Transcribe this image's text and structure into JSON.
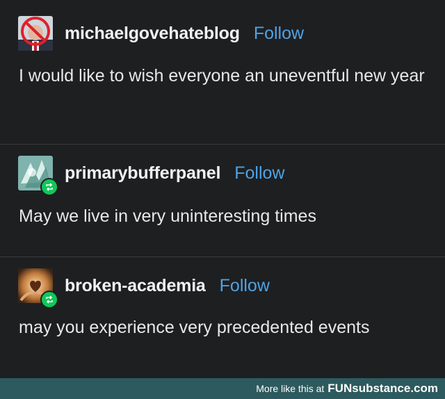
{
  "posts": [
    {
      "username": "michaelgovehateblog",
      "follow_label": "Follow",
      "text": "I would like to wish everyone an uneventful new year",
      "avatar": "portrait-with-red-prohibition-sign",
      "reblog": false
    },
    {
      "username": "primarybufferpanel",
      "follow_label": "Follow",
      "text": "May we live in very uninteresting times",
      "avatar": "cyan-abstract-art",
      "reblog": true
    },
    {
      "username": "broken-academia",
      "follow_label": "Follow",
      "text": "may you experience very precedented events",
      "avatar": "hands-holding-heart",
      "reblog": true
    }
  ],
  "footer": {
    "prefix": "More like this at",
    "brand": "FUNsubstance.com"
  },
  "colors": {
    "background": "#1e1f21",
    "follow": "#4da3e6",
    "reblog_badge": "#10c75a",
    "footer": "#2d5a5e"
  }
}
